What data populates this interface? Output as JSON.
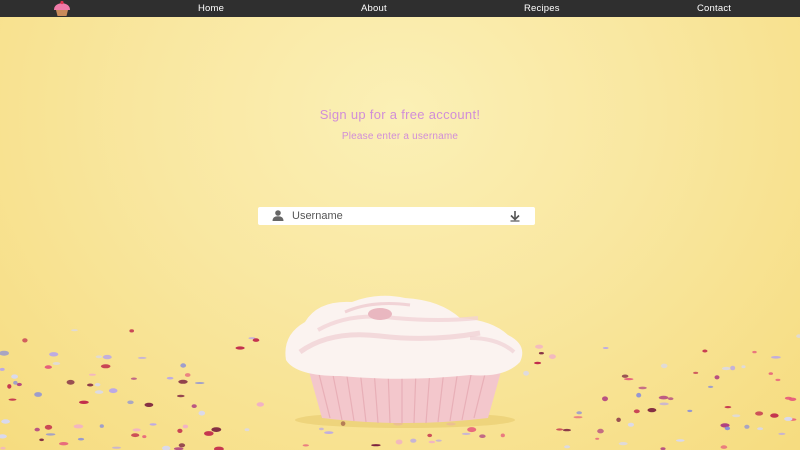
{
  "nav": {
    "logo": "cupcake-logo",
    "items": [
      {
        "label": "Home"
      },
      {
        "label": "About"
      },
      {
        "label": "Recipes"
      },
      {
        "label": "Contact"
      }
    ]
  },
  "signup": {
    "title": "Sign up for a free account!",
    "subtitle": "Please enter a username",
    "username": {
      "placeholder": "Username",
      "value": "",
      "icon": "user-icon",
      "submit_icon": "arrow-down-icon"
    }
  },
  "background": {
    "image": "cupcake-with-confetti",
    "colors": {
      "base": "#f8e58f",
      "navbar": "#2f2f2f",
      "accent": "#d18ed8"
    }
  }
}
